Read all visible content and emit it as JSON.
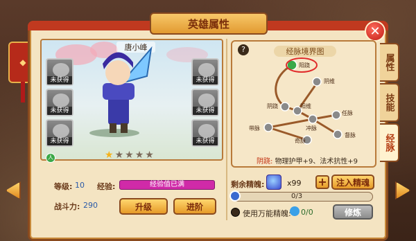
{
  "window": {
    "title": "英雄属性",
    "close_icon": "close-icon"
  },
  "side_tabs": [
    {
      "label": "属性",
      "active": false
    },
    {
      "label": "技能",
      "active": false
    },
    {
      "label": "经脉",
      "active": true
    }
  ],
  "hero": {
    "name": "唐小峰",
    "stars_total": 5,
    "stars_filled": 1,
    "equip_slots": [
      {
        "label": "未获得",
        "icon": "helmet-icon"
      },
      {
        "label": "未获得",
        "icon": "armor-icon"
      },
      {
        "label": "未获得",
        "icon": "necklace-icon"
      },
      {
        "label": "未获得",
        "icon": "ring-icon"
      },
      {
        "label": "未获得",
        "icon": "bracelet-icon"
      },
      {
        "label": "未获得",
        "icon": "boots-icon"
      }
    ],
    "badge": "人"
  },
  "stats": {
    "level_label": "等级:",
    "level_value": "10",
    "exp_label": "经验:",
    "exp_text": "经验值已满",
    "power_label": "战斗力:",
    "power_value": "290"
  },
  "buttons": {
    "upgrade": "升级",
    "advance": "进阶",
    "inject": "注入精魂",
    "cultivate": "修炼"
  },
  "meridian": {
    "help": "?",
    "title": "经脉境界图",
    "nodes": [
      {
        "label": "阳跷",
        "active": true
      },
      {
        "label": "阴维"
      },
      {
        "label": "阴跷"
      },
      {
        "label": "阳维"
      },
      {
        "label": "任脉"
      },
      {
        "label": "带脉"
      },
      {
        "label": "冲脉"
      },
      {
        "label": "督脉"
      },
      {
        "label": "奇脉"
      }
    ],
    "effect_name": "阴跷:",
    "effect_text": "物理护甲+9、法术抗性+9"
  },
  "essence": {
    "label": "剩余精魄:",
    "count": "x99",
    "progress_text": "0/3",
    "progress_fraction": 0,
    "use_label": "使用万能精魄:",
    "use_value": "0/0"
  }
}
